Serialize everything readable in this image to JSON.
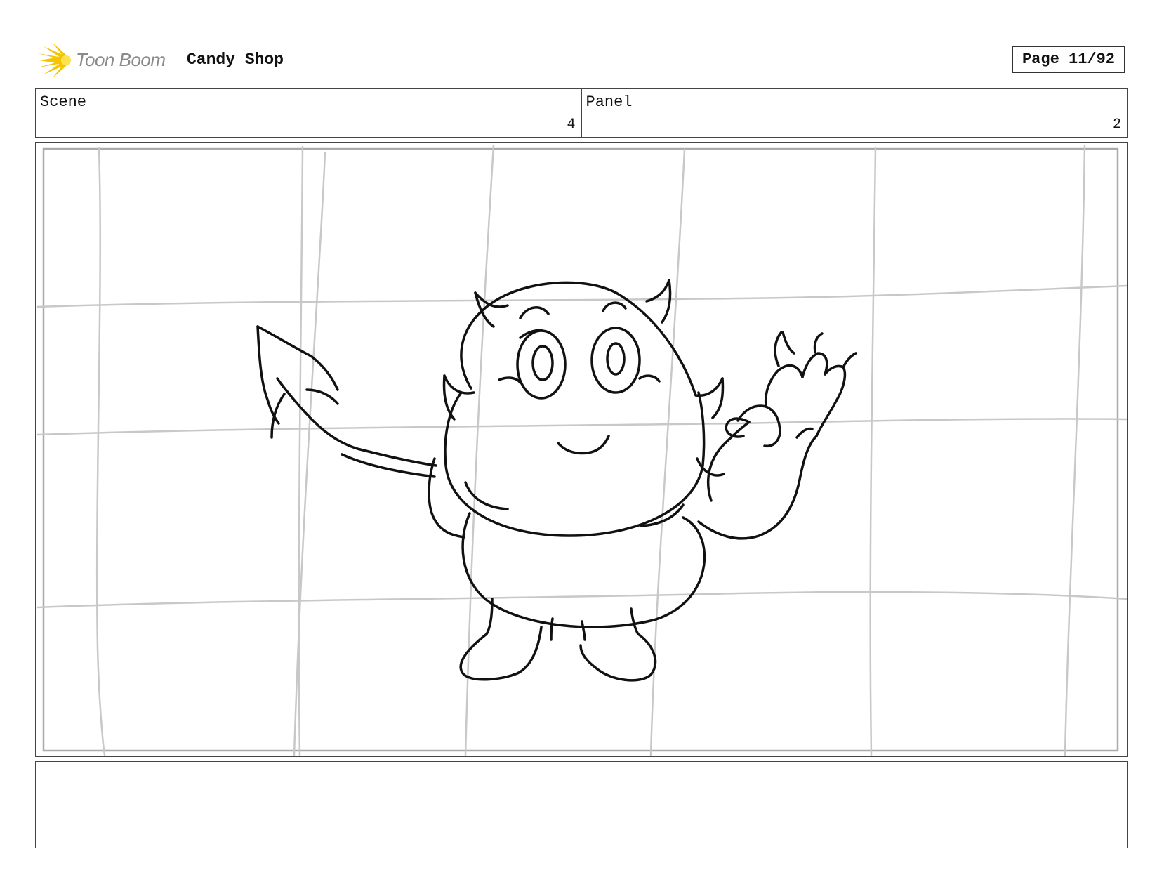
{
  "header": {
    "logo_text": "Toon Boom",
    "project_title": "Candy Shop",
    "page_label": "Page 11/92"
  },
  "info": {
    "scene_label": "Scene",
    "scene_value": "4",
    "panel_label": "Panel",
    "panel_value": "2"
  },
  "panel": {
    "drawing_icon": "devil-character-sketch"
  },
  "notes": {
    "text": ""
  },
  "colors": {
    "logo_flare": "#f5c400",
    "logo_text": "#8a8a8a",
    "border": "#444444",
    "grid": "#c8c8c8",
    "ink": "#111111"
  }
}
